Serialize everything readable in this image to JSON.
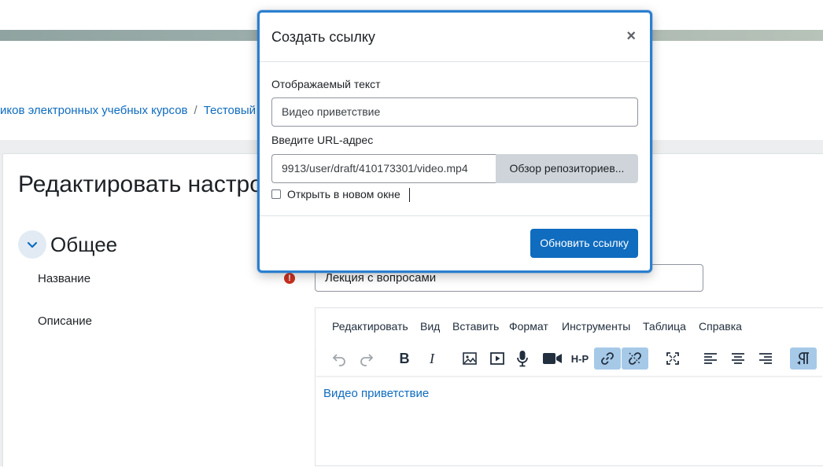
{
  "breadcrumb": {
    "items": [
      "иков электронных учебных курсов",
      "Тестовый"
    ],
    "separator": "/"
  },
  "page": {
    "title": "Редактировать настрой",
    "section_title": "Общее",
    "name_label": "Название",
    "name_value": "Лекция с вопросами",
    "description_label": "Описание",
    "required_icon": "!"
  },
  "editor": {
    "menu": [
      "Редактировать",
      "Вид",
      "Вставить",
      "Формат",
      "Инструменты",
      "Таблица",
      "Справка"
    ],
    "toolbar_icons": [
      "undo-icon",
      "redo-icon",
      "bold-icon",
      "italic-icon",
      "image-icon",
      "media-icon",
      "microphone-icon",
      "video-camera-icon",
      "h5p-icon",
      "link-icon",
      "unlink-icon",
      "fullscreen-icon",
      "align-left-icon",
      "align-center-icon",
      "align-right-icon",
      "paragraph-direction-icon"
    ],
    "toolbar_text": {
      "bold": "B",
      "italic": "I",
      "h5p": "H-P"
    },
    "content_link": "Видео приветствие"
  },
  "modal": {
    "title": "Создать ссылку",
    "close": "×",
    "display_text_label": "Отображаемый текст",
    "display_text_value": "Видео приветствие",
    "url_label": "Введите URL-адрес",
    "url_value": "9913/user/draft/410173301/video.mp4",
    "browse_button": "Обзор репозиториев...",
    "new_window_label": "Открыть в новом окне",
    "new_window_checked": false,
    "submit_button": "Обновить ссылку"
  },
  "colors": {
    "accent": "#0f6cbf",
    "modal_border": "#2b7fcf",
    "required": "#ca3120",
    "toolbar_active": "#a6c9e8"
  }
}
